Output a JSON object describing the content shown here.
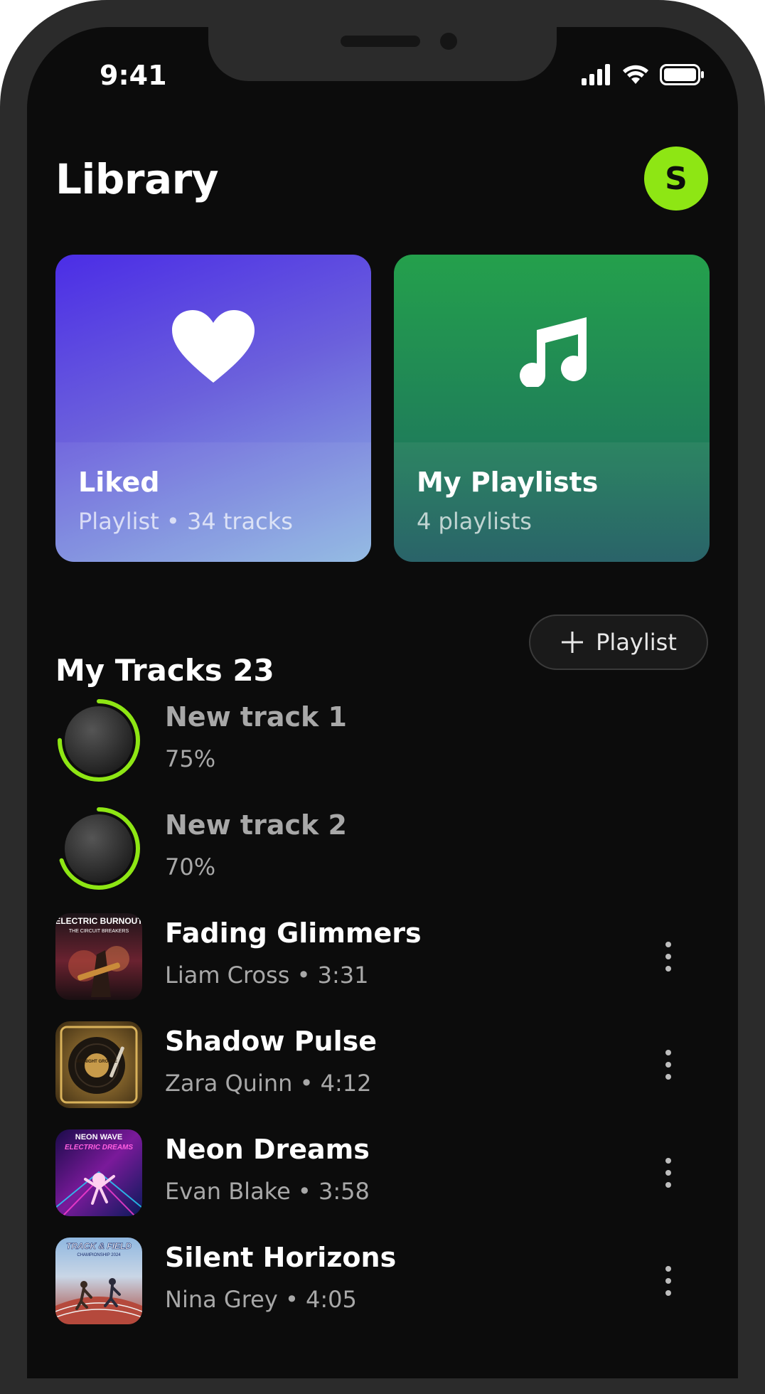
{
  "status_bar": {
    "time": "9:41"
  },
  "header": {
    "title": "Library",
    "avatar_initial": "S"
  },
  "cards": [
    {
      "title": "Liked",
      "subtitle": "Playlist • 34 tracks",
      "icon": "heart-icon"
    },
    {
      "title": "My Playlists",
      "subtitle": "4 playlists",
      "icon": "music-note-icon"
    }
  ],
  "section": {
    "title": "My Tracks 23",
    "add_playlist_label": "Playlist"
  },
  "tracks": [
    {
      "name": "New track 1",
      "meta": "75%",
      "state": "uploading",
      "progress": 0.75
    },
    {
      "name": "New track 2",
      "meta": "70%",
      "state": "uploading",
      "progress": 0.7
    },
    {
      "name": "Fading Glimmers",
      "meta": "Liam Cross • 3:31",
      "state": "ready",
      "art_text": "ELECTRIC BURNOUT",
      "art_subtext": "THE CIRCUIT BREAKERS"
    },
    {
      "name": "Shadow Pulse",
      "meta": "Zara Quinn • 4:12",
      "state": "ready",
      "art_text": "MIDNIGHT GROOVE"
    },
    {
      "name": "Neon Dreams",
      "meta": "Evan Blake • 3:58",
      "state": "ready",
      "art_text": "NEON WAVE",
      "art_subtext": "ELECTRIC DREAMS"
    },
    {
      "name": "Silent Horizons",
      "meta": "Nina Grey • 4:05",
      "state": "ready",
      "art_text": "TRACK & FIELD",
      "art_subtext": "CHAMPIONSHIP 2024"
    }
  ],
  "colors": {
    "accent": "#8ee614",
    "background": "#0c0c0c",
    "liked_card": "#5a40e0",
    "playlists_card": "#23914f"
  }
}
